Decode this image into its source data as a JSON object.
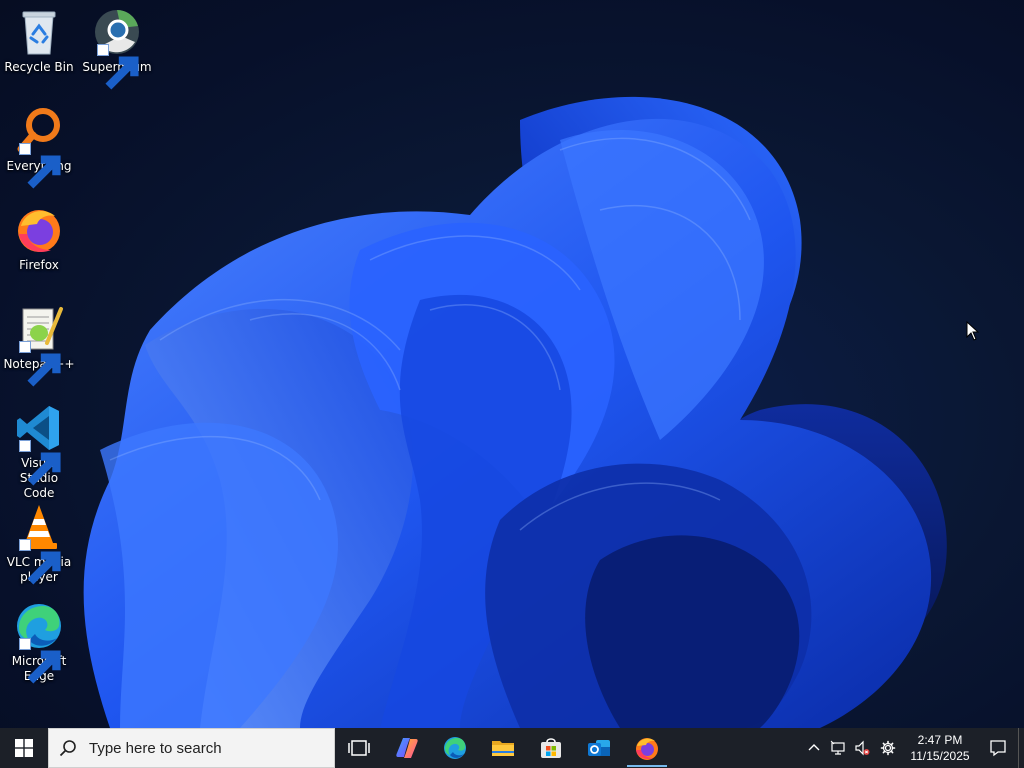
{
  "desktop": {
    "icons": [
      {
        "label": "Recycle Bin",
        "icon": "recycle-bin-icon"
      },
      {
        "label": "Supermium",
        "icon": "supermium-icon"
      },
      {
        "label": "Everything",
        "icon": "everything-search-icon"
      },
      {
        "label": "Firefox",
        "icon": "firefox-icon"
      },
      {
        "label": "Notepad++",
        "icon": "notepad-plus-plus-icon"
      },
      {
        "label": "Visual Studio Code",
        "icon": "vscode-icon"
      },
      {
        "label": "VLC media player",
        "icon": "vlc-icon"
      },
      {
        "label": "Microsoft Edge",
        "icon": "edge-icon"
      }
    ]
  },
  "taskbar": {
    "search_placeholder": "Type here to search",
    "apps": [
      "task-view",
      "copilot",
      "edge",
      "file-explorer",
      "microsoft-store",
      "outlook",
      "firefox"
    ],
    "running_app": "firefox",
    "clock": {
      "time": "2:47 PM",
      "date": "11/15/2025"
    }
  },
  "colors": {
    "taskbar_bg": "#1c2028",
    "accent_indicator": "#76b9ed",
    "wallpaper_blue": "#1f5bff"
  }
}
